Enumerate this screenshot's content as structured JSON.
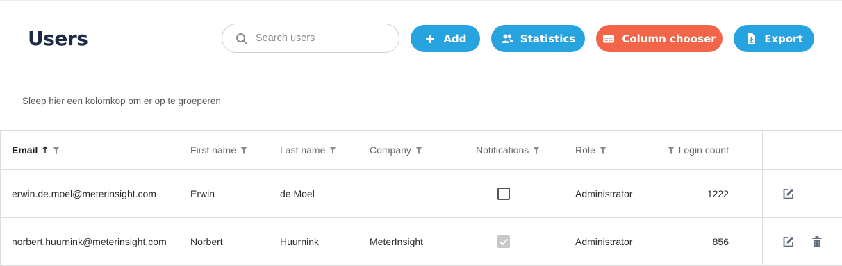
{
  "page": {
    "title": "Users"
  },
  "search": {
    "placeholder": "Search users",
    "value": ""
  },
  "toolbar": {
    "add_label": "Add",
    "statistics_label": "Statistics",
    "column_chooser_label": "Column chooser",
    "export_label": "Export"
  },
  "colors": {
    "primary": "#27a4e0",
    "accent": "#f26549",
    "title": "#1d2b44"
  },
  "group_panel": {
    "text": "Sleep hier een kolomkop om er op te groeperen"
  },
  "grid": {
    "columns": [
      {
        "label": "Email",
        "sort": "ascending"
      },
      {
        "label": "First name"
      },
      {
        "label": "Last name"
      },
      {
        "label": "Company"
      },
      {
        "label": "Notifications"
      },
      {
        "label": "Role"
      },
      {
        "label": "Login count"
      }
    ],
    "rows": [
      {
        "email": "erwin.de.moel@meterinsight.com",
        "first_name": "Erwin",
        "last_name": "de Moel",
        "company": "",
        "notifications": false,
        "role": "Administrator",
        "login_count": "1222",
        "actions": [
          "edit-icon"
        ]
      },
      {
        "email": "norbert.huurnink@meterinsight.com",
        "first_name": "Norbert",
        "last_name": "Huurnink",
        "company": "MeterInsight",
        "notifications": true,
        "role": "Administrator",
        "login_count": "856",
        "actions": [
          "edit-icon",
          "trash-icon"
        ]
      }
    ]
  }
}
